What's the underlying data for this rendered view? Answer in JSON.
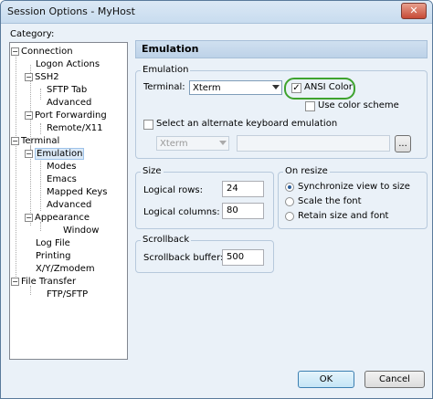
{
  "window": {
    "title": "Session Options - MyHost",
    "close_glyph": "✕"
  },
  "category_label": "Category:",
  "tree": {
    "expand_glyph": "−",
    "items": [
      "Connection",
      "Logon Actions",
      "SSH2",
      "SFTP Tab",
      "Advanced",
      "Port Forwarding",
      "Remote/X11",
      "Terminal",
      "Emulation",
      "Modes",
      "Emacs",
      "Mapped Keys",
      "Advanced",
      "Appearance",
      "Window",
      "Log File",
      "Printing",
      "X/Y/Zmodem",
      "File Transfer",
      "FTP/SFTP"
    ],
    "selected": "Emulation"
  },
  "panel_header": "Emulation",
  "emulation": {
    "group_title": "Emulation",
    "terminal_label": "Terminal:",
    "terminal_value": "Xterm",
    "ansi_color_label": "ANSI Color",
    "ansi_color_checked": true,
    "use_color_scheme_label": "Use color scheme",
    "use_color_scheme_checked": false,
    "alternate_label": "Select an alternate keyboard emulation",
    "alternate_checked": false,
    "alternate_value": "Xterm",
    "browse_label": "..."
  },
  "size": {
    "group_title": "Size",
    "rows_label": "Logical rows:",
    "rows_value": "24",
    "cols_label": "Logical columns:",
    "cols_value": "80"
  },
  "on_resize": {
    "group_title": "On resize",
    "options": [
      "Synchronize view to size",
      "Scale the font",
      "Retain size and font"
    ],
    "selected_index": 0
  },
  "scrollback": {
    "group_title": "Scrollback",
    "buffer_label": "Scrollback buffer:",
    "buffer_value": "500"
  },
  "buttons": {
    "ok": "OK",
    "cancel": "Cancel"
  },
  "colors": {
    "highlight": "#3ea32e",
    "accent": "#3c7fb1"
  }
}
